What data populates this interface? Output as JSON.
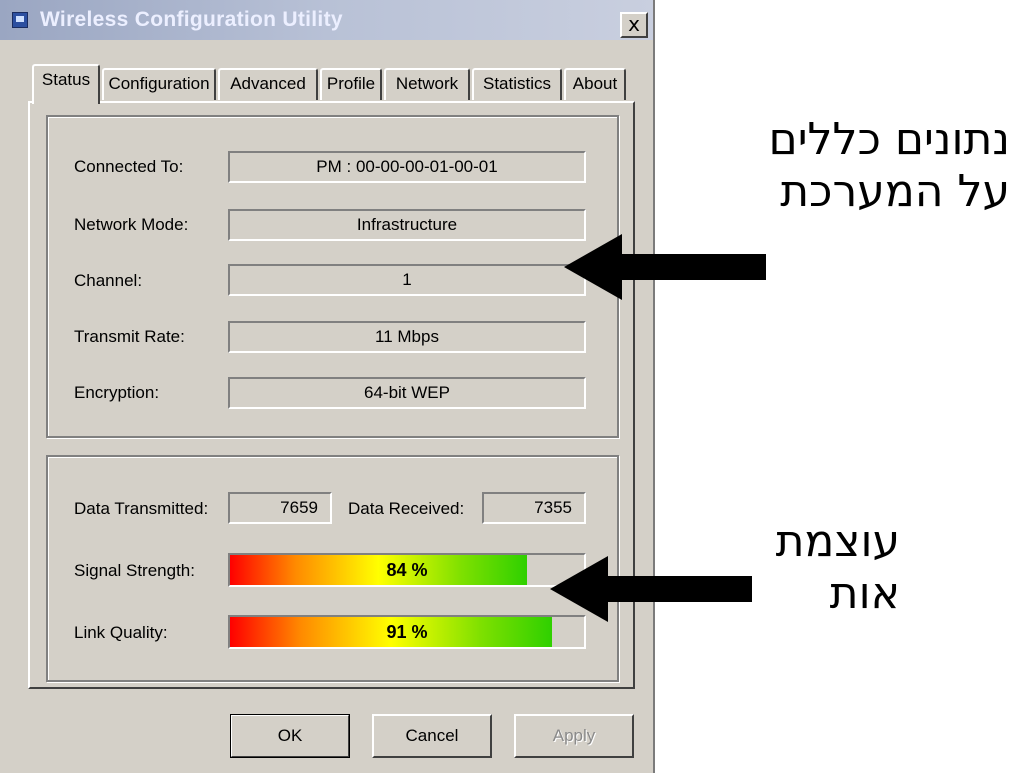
{
  "window": {
    "title": "Wireless Configuration Utility",
    "close_label": "x"
  },
  "tabs": [
    {
      "label": "Status",
      "active": true
    },
    {
      "label": "Configuration"
    },
    {
      "label": "Advanced"
    },
    {
      "label": "Profile"
    },
    {
      "label": "Network"
    },
    {
      "label": "Statistics"
    },
    {
      "label": "About"
    }
  ],
  "status": {
    "connected_to": {
      "label": "Connected To:",
      "value": "PM : 00-00-00-01-00-01"
    },
    "network_mode": {
      "label": "Network Mode:",
      "value": "Infrastructure"
    },
    "channel": {
      "label": "Channel:",
      "value": "1"
    },
    "transmit_rate": {
      "label": "Transmit Rate:",
      "value": "11 Mbps"
    },
    "encryption": {
      "label": "Encryption:",
      "value": "64-bit WEP"
    }
  },
  "traffic": {
    "transmitted_label": "Data Transmitted:",
    "transmitted_value": "7659",
    "received_label": "Data Received:",
    "received_value": "7355"
  },
  "signal": {
    "label": "Signal Strength:",
    "percent": 84,
    "text": "84 %"
  },
  "link": {
    "label": "Link Quality:",
    "percent": 91,
    "text": "91 %"
  },
  "buttons": {
    "ok": "OK",
    "cancel": "Cancel",
    "apply": "Apply"
  },
  "annotations": {
    "system_info_line1": "נתונים כללים",
    "system_info_line2": "על המערכת",
    "signal_line1": "עוצמת",
    "signal_line2": "אות"
  }
}
